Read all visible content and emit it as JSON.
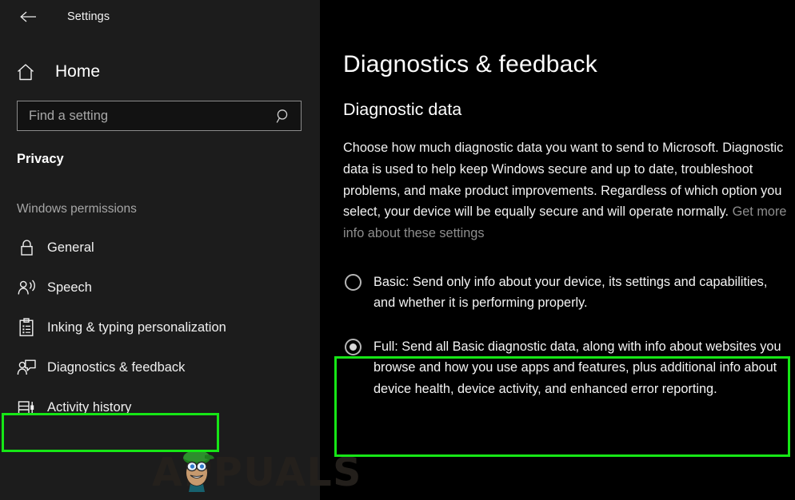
{
  "window": {
    "back_icon": "back-arrow-icon",
    "title": "Settings"
  },
  "sidebar": {
    "home": {
      "icon": "home-icon",
      "label": "Home"
    },
    "search": {
      "icon": "search-icon",
      "placeholder": "Find a setting",
      "value": ""
    },
    "category": "Privacy",
    "group_header": "Windows permissions",
    "items": [
      {
        "icon": "lock-icon",
        "label": "General",
        "selected": false
      },
      {
        "icon": "speech-person-icon",
        "label": "Speech",
        "selected": false
      },
      {
        "icon": "clipboard-icon",
        "label": "Inking & typing personalization",
        "selected": false
      },
      {
        "icon": "feedback-person-icon",
        "label": "Diagnostics & feedback",
        "selected": true
      },
      {
        "icon": "activity-history-icon",
        "label": "Activity history",
        "selected": false
      }
    ]
  },
  "main": {
    "page_title": "Diagnostics & feedback",
    "section_title": "Diagnostic data",
    "description": "Choose how much diagnostic data you want to send to Microsoft. Diagnostic data is used to help keep Windows secure and up to date, troubleshoot problems, and make product improvements. Regardless of which option you select, your device will be equally secure and will operate normally. ",
    "description_link": "Get more info about these settings",
    "options": [
      {
        "id": "basic",
        "label": "Basic: Send only info about your device, its settings and capabilities, and whether it is performing properly.",
        "checked": false
      },
      {
        "id": "full",
        "label": "Full: Send all Basic diagnostic data, along with info about websites you browse and how you use apps and features, plus additional info about device health, device activity, and enhanced error reporting.",
        "checked": true
      }
    ]
  },
  "annotations": {
    "highlight_color": "#16e616",
    "sidebar_highlight_target": "Diagnostics & feedback",
    "option_highlight_target": "Full"
  },
  "watermark": {
    "text": "APPUALS"
  }
}
